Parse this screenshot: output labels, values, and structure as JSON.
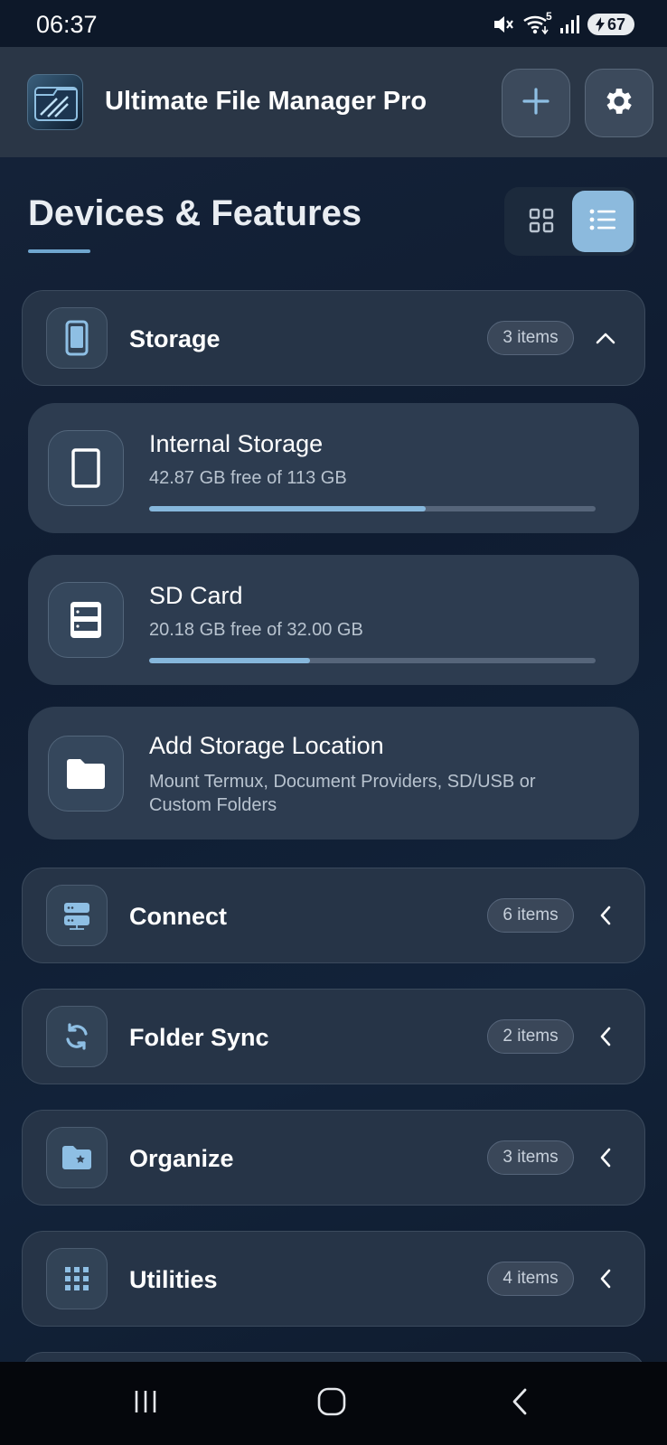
{
  "status_bar": {
    "time": "06:37",
    "wifi_label": "5",
    "battery": "67"
  },
  "header": {
    "app_title": "Ultimate File Manager Pro",
    "add_icon": "plus-icon",
    "settings_icon": "gear-icon"
  },
  "section": {
    "title": "Devices & Features",
    "view_modes": [
      "grid",
      "list"
    ],
    "selected_view": "list"
  },
  "categories": [
    {
      "label": "Storage",
      "badge": "3 items",
      "expanded": true,
      "icon": "phone-icon"
    },
    {
      "label": "Connect",
      "badge": "6 items",
      "expanded": false,
      "icon": "server-icon"
    },
    {
      "label": "Folder Sync",
      "badge": "2 items",
      "expanded": false,
      "icon": "sync-icon"
    },
    {
      "label": "Organize",
      "badge": "3 items",
      "expanded": false,
      "icon": "star-folder-icon"
    },
    {
      "label": "Utilities",
      "badge": "4 items",
      "expanded": false,
      "icon": "grid-apps-icon"
    }
  ],
  "storage_items": [
    {
      "title": "Internal Storage",
      "subtitle": "42.87 GB free of 113 GB",
      "used_fraction": 0.62,
      "icon": "tablet-icon"
    },
    {
      "title": "SD Card",
      "subtitle": "20.18 GB free of 32.00 GB",
      "used_fraction": 0.36,
      "icon": "sd-card-icon"
    },
    {
      "title": "Add Storage Location",
      "subtitle": "Mount Termux, Document Providers, SD/USB or Custom Folders",
      "icon": "folder-icon"
    }
  ],
  "colors": {
    "accent": "#86b7dc",
    "background": "#0f1c31",
    "card": "#263447"
  }
}
